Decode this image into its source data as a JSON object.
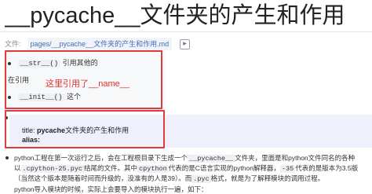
{
  "page": {
    "title": "__pycache__文件夹的产生和作用"
  },
  "file_row": {
    "label": "文件:",
    "path": "pages/__pycache__文件夹的产生和作用.md",
    "open_icon": "arrow-right-icon",
    "open_glyph": "▶"
  },
  "list1": {
    "item1_code": "__str__()",
    "item1_text": "引用其他的",
    "item2_text": "在引用",
    "item3_code": "__init__()",
    "item3_text": "这个"
  },
  "annotation": {
    "text": "这里引用了__name__",
    "color": "#e03030"
  },
  "yaml": {
    "title_key": "title:",
    "title_value_bold": "pycache",
    "title_value_rest": "文件夹的产生和作用",
    "alias_key": "alias:"
  },
  "paragraph": {
    "t1": "python工程在第一次运行之后，会在工程根目录下生成一个",
    "c1": "__pycache__",
    "t2": "文件夹，里面是和python文件同名的各种以",
    "c2": ".cpython-25.pyc",
    "t3": "结尾的文件。其中",
    "c3": "cpython",
    "t4": "代表的是C语言实现的python解释器，",
    "c4": "-35",
    "t5": "代表的是版本为3.5版（当然这个版本是随着时间而升级的，没准有的人是39）。而",
    "c5": ".pyc",
    "t6": "格式，就是为了解释模块的调用过程。",
    "cut": "python导入模块的时候，实际上会要导入的模块执行一遍，如下："
  },
  "colors": {
    "red_box": "#e03a3a",
    "link": "#3f6fb5",
    "yaml_bg": "#eef0fb"
  }
}
